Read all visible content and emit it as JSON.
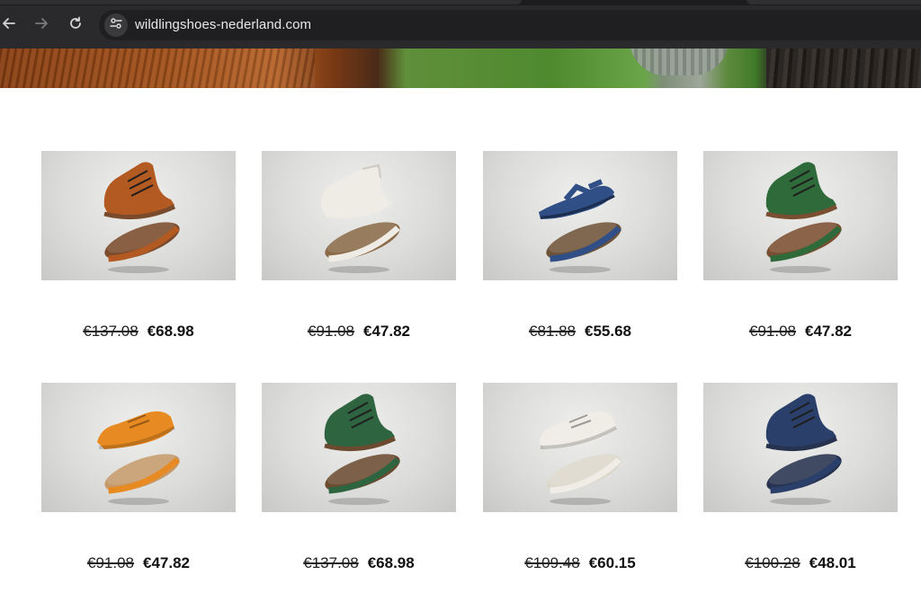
{
  "browser": {
    "url": "wildlingshoes-nederland.com",
    "nav_icons": [
      "back-arrow-icon",
      "forward-arrow-icon",
      "reload-icon",
      "site-settings-icon"
    ]
  },
  "products": [
    {
      "old_price": "€137.08",
      "new_price": "€68.98",
      "color": "#b25a22",
      "sole": "#7a4a2c",
      "style": "boot"
    },
    {
      "old_price": "€91.08",
      "new_price": "€47.82",
      "color": "#efece6",
      "sole": "#8a6a48",
      "style": "slipper"
    },
    {
      "old_price": "€81.88",
      "new_price": "€55.68",
      "color": "#2f4f86",
      "sole": "#6e5238",
      "style": "sandal"
    },
    {
      "old_price": "€91.08",
      "new_price": "€47.82",
      "color": "#2f6a3a",
      "sole": "#7a4e30",
      "style": "boot"
    },
    {
      "old_price": "€91.08",
      "new_price": "€47.82",
      "color": "#e88a22",
      "sole": "#c49a6a",
      "style": "low"
    },
    {
      "old_price": "€137.08",
      "new_price": "€68.98",
      "color": "#2e6440",
      "sole": "#6b4a30",
      "style": "boot"
    },
    {
      "old_price": "€109.48",
      "new_price": "€60.15",
      "color": "#f0ede6",
      "sole": "#dcd8cc",
      "style": "low"
    },
    {
      "old_price": "€100.28",
      "new_price": "€48.01",
      "color": "#2a3f6a",
      "sole": "#26324e",
      "style": "boot"
    }
  ]
}
